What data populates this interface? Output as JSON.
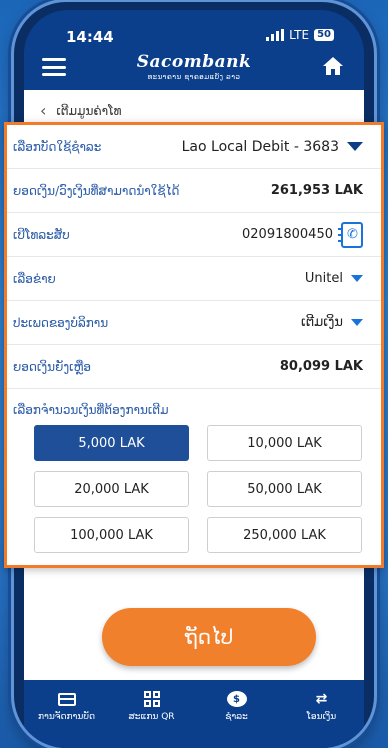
{
  "status": {
    "time": "14:44",
    "network": "LTE",
    "battery": "50"
  },
  "header": {
    "brand": "Sacombank",
    "brand_sub": "ທະນາຄານ ຊາຄອມແບັງ ລາວ"
  },
  "breadcrumb": {
    "title": "ເຕີມມູນຄ່າໂທ"
  },
  "form": {
    "account": {
      "label": "ເລືອກບັດໃຊ້ຊຳລະ",
      "value": "Lao Local Debit - 3683"
    },
    "available": {
      "label": "ຍອດເງິນ/ວົງເງິນທີ່ສາມາດນຳໃຊ້ໄດ້",
      "value": "261,953 LAK"
    },
    "phone": {
      "label": "ເບີໂທລະສັບ",
      "value": "02091800450"
    },
    "network": {
      "label": "ເລືອຂ່າຍ",
      "value": "Unitel"
    },
    "service": {
      "label": "ປະເພດຂອງບໍລິການ",
      "value": "ເຕີມເງິນ"
    },
    "remaining": {
      "label": "ຍອດເງິນຍັງເຫຼືອ",
      "value": "80,099 LAK"
    },
    "amount_label": "ເລືອກຈຳນວນເງິນທີ່ຕ້ອງການເຕີມ",
    "amounts": [
      "5,000 LAK",
      "10,000 LAK",
      "20,000 LAK",
      "50,000 LAK",
      "100,000 LAK",
      "250,000 LAK"
    ],
    "selected_amount": "5,000 LAK"
  },
  "next_button": "ຖັດໄປ",
  "bottom_nav": [
    {
      "label": "ການຈັດການບັດ",
      "icon": "card-icon"
    },
    {
      "label": "ສະແກນ QR",
      "icon": "qr-icon"
    },
    {
      "label": "ຊຳລະ",
      "icon": "payment-icon"
    },
    {
      "label": "ໂອນເງິນ",
      "icon": "transfer-icon"
    }
  ],
  "colors": {
    "accent": "#f07b2b",
    "primary": "#0b3f8c",
    "selected": "#1f4f98"
  }
}
